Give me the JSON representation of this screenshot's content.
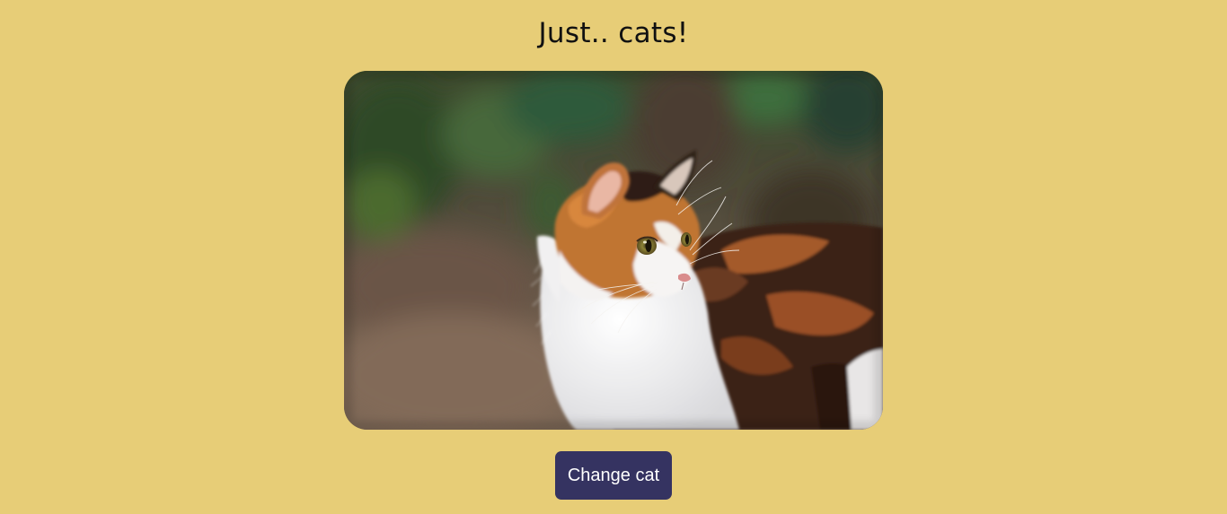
{
  "page": {
    "title": "Just.. cats!"
  },
  "photo": {
    "subject": "calico-cat-photo"
  },
  "controls": {
    "change_label": "Change cat"
  },
  "colors": {
    "background": "#e7cd77",
    "button": "#353361",
    "button_text": "#ffffff"
  }
}
